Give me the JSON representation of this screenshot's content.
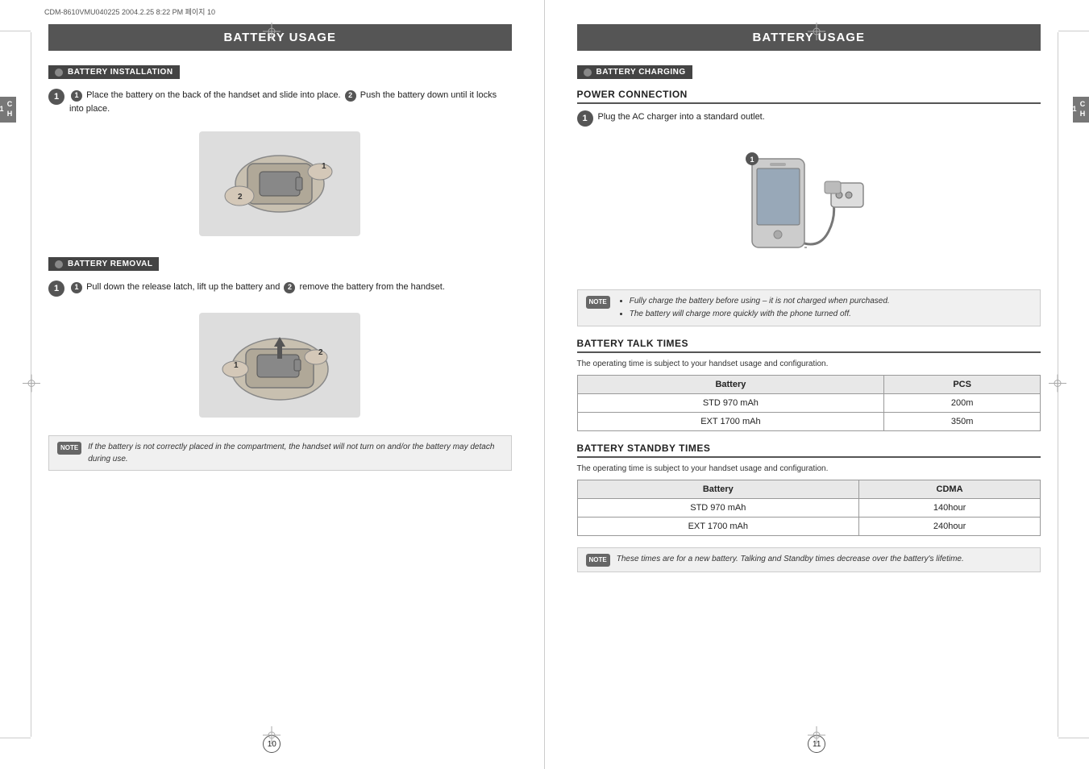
{
  "print_info": "CDM-8610VMU040225  2004.2.25 8:22 PM  페이지 10",
  "left_page": {
    "header": "BATTERY USAGE",
    "ch_tab": "CH\n1",
    "section1": {
      "label": "BATTERY INSTALLATION",
      "step1_text": "Place the battery on the back of the handset and slide into place.",
      "step1_num2": "Push the battery down until it locks into place.",
      "img_alt": "Battery installation diagram"
    },
    "section2": {
      "label": "BATTERY REMOVAL",
      "step1_text": "Pull down the release latch, lift up the battery and",
      "step1_num2": "remove the battery from the handset.",
      "img_alt": "Battery removal diagram"
    },
    "note": {
      "badge": "NOTE",
      "text": "If the battery is not correctly placed in the compartment, the handset will not turn on and/or the battery may detach during use."
    },
    "page_number": "10"
  },
  "right_page": {
    "header": "BATTERY USAGE",
    "ch_tab": "CH\n1",
    "section1": {
      "label": "BATTERY CHARGING",
      "subsection": "POWER CONNECTION",
      "step1_text": "Plug the AC charger into a standard outlet.",
      "img_alt": "Phone charging diagram"
    },
    "note": {
      "badge": "NOTE",
      "bullet1": "Fully charge the battery before using – it is not charged when purchased.",
      "bullet2": "The battery will charge more quickly with the phone turned off."
    },
    "talk_times": {
      "title": "BATTERY TALK TIMES",
      "subtitle": "The operating time is subject to your handset usage and configuration.",
      "headers": [
        "Battery",
        "PCS"
      ],
      "rows": [
        [
          "STD 970 mAh",
          "200m"
        ],
        [
          "EXT 1700 mAh",
          "350m"
        ]
      ]
    },
    "standby_times": {
      "title": "BATTERY STANDBY TIMES",
      "subtitle": "The operating time is subject to your handset usage and configuration.",
      "headers": [
        "Battery",
        "CDMA"
      ],
      "rows": [
        [
          "STD 970 mAh",
          "140hour"
        ],
        [
          "EXT 1700 mAh",
          "240hour"
        ]
      ]
    },
    "note2": {
      "badge": "NOTE",
      "text": "These times are for a new battery. Talking and Standby times decrease over the battery's lifetime."
    },
    "page_number": "11"
  }
}
